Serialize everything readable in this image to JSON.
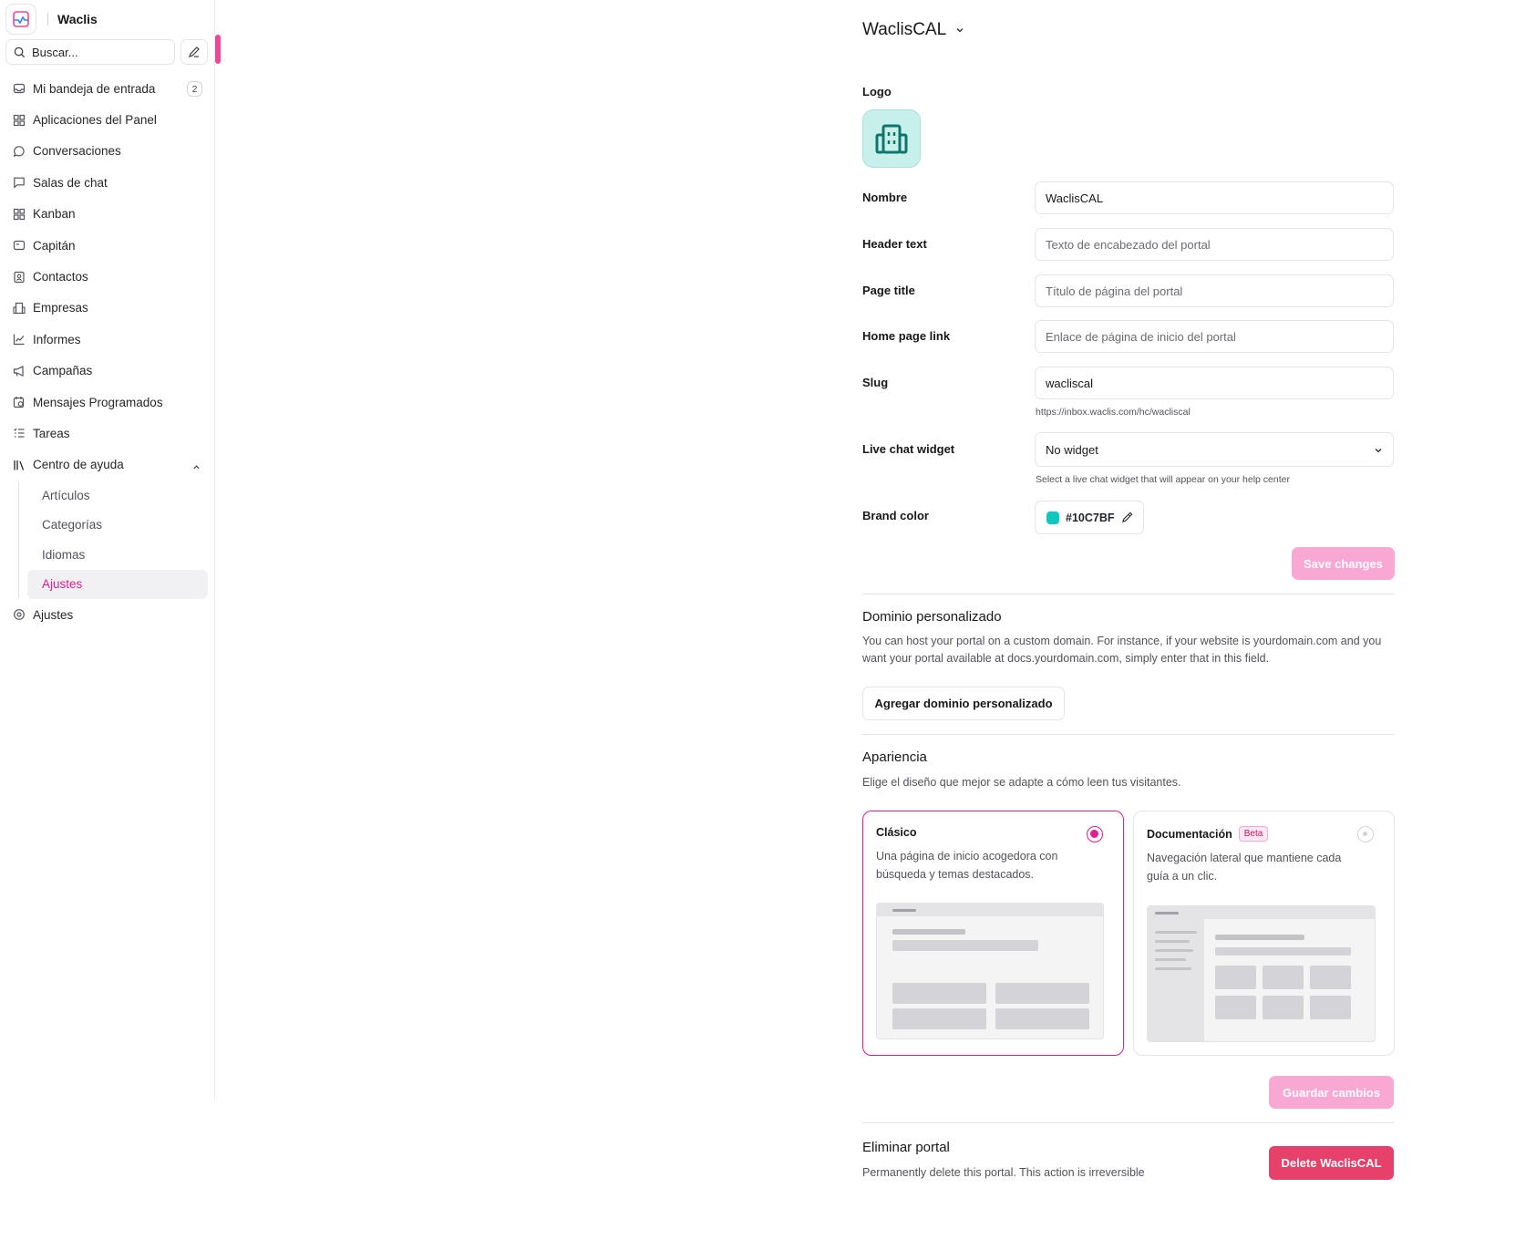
{
  "app": {
    "name": "Waclis"
  },
  "search": {
    "placeholder": "Buscar..."
  },
  "sidebar": {
    "items": [
      {
        "label": "Mi bandeja de entrada",
        "badge": "2"
      },
      {
        "label": "Aplicaciones del Panel"
      },
      {
        "label": "Conversaciones"
      },
      {
        "label": "Salas de chat"
      },
      {
        "label": "Kanban"
      },
      {
        "label": "Capitán"
      },
      {
        "label": "Contactos"
      },
      {
        "label": "Empresas"
      },
      {
        "label": "Informes"
      },
      {
        "label": "Campañas"
      },
      {
        "label": "Mensajes Programados"
      },
      {
        "label": "Tareas"
      },
      {
        "label": "Centro de ayuda"
      }
    ],
    "help_center_sub": [
      "Artículos",
      "Categorías",
      "Idiomas",
      "Ajustes"
    ],
    "settings": "Ajustes",
    "active_color": "#e11d8f"
  },
  "portal": {
    "title": "WaclisCAL",
    "logo_label": "Logo",
    "name_label": "Nombre",
    "name_value": "WaclisCAL",
    "header_label": "Header text",
    "header_placeholder": "Texto de encabezado del portal",
    "page_title_label": "Page title",
    "page_title_placeholder": "Título de página del portal",
    "home_link_label": "Home page link",
    "home_link_placeholder": "Enlace de página de inicio del portal",
    "slug_label": "Slug",
    "slug_value": "wacliscal",
    "slug_hint": "https://inbox.waclis.com/hc/wacliscal",
    "widget_label": "Live chat widget",
    "widget_value": "No widget",
    "widget_hint": "Select a live chat widget that will appear on your help center",
    "brand_label": "Brand color",
    "brand_value": "#10C7BF",
    "save_label": "Save changes"
  },
  "domain": {
    "title": "Dominio personalizado",
    "desc": "You can host your portal on a custom domain. For instance, if your website is yourdomain.com and you want your portal available at docs.yourdomain.com, simply enter that in this field.",
    "button": "Agregar dominio personalizado"
  },
  "appearance": {
    "title": "Apariencia",
    "desc": "Elige el diseño que mejor se adapte a cómo leen tus visitantes.",
    "classic_title": "Clásico",
    "classic_desc": "Una página de inicio acogedora con búsqueda y temas destacados.",
    "docs_title": "Documentación",
    "docs_badge": "Beta",
    "docs_desc": "Navegación lateral que mantiene cada guía a un clic.",
    "selected": "Clásico",
    "save_label": "Guardar cambios"
  },
  "delete": {
    "title": "Eliminar portal",
    "desc": "Permanently delete this portal. This action is irreversible",
    "button": "Delete WaclisCAL"
  }
}
